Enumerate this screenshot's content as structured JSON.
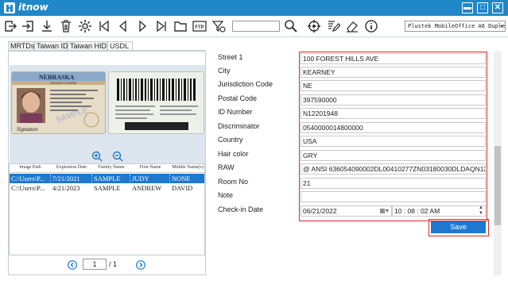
{
  "app": {
    "name": "itnow"
  },
  "window_controls": {
    "minimize": "▬",
    "maximize": "□",
    "close": "✕"
  },
  "toolbar": {
    "icons": [
      "export-icon",
      "login-icon",
      "download-icon",
      "trash-icon",
      "gear-icon",
      "skip-back-icon",
      "prev-icon",
      "next-icon",
      "skip-forward-icon",
      "folder-icon",
      "ftp-icon",
      "filter-icon",
      "search-icon",
      "target-icon",
      "edit-icon",
      "eraser-icon",
      "info-icon"
    ],
    "ftp_label": "FTP",
    "search_value": "",
    "scanner": "Plustek MobileOffice A6 Duplex S"
  },
  "tabs": [
    "MRTDs",
    "Taiwan ID",
    "Taiwan HID",
    "USDL"
  ],
  "active_tab": "USDL",
  "license": {
    "state": "NEBRASKA",
    "header_sub": "DRIVER LICENSE",
    "watermark": "SAMPLE",
    "signature": "Signature"
  },
  "records": {
    "columns": [
      "Image Path",
      "Expiration Date",
      "Family Name",
      "First Name",
      "Middle Name(s)"
    ],
    "rows": [
      [
        "C:\\Users\\P...",
        "7/21/2021",
        "SAMPLE",
        "JUDY",
        "NONE"
      ],
      [
        "C:\\Users\\P...",
        "4/21/2023",
        "SAMPLE",
        "ANDREW",
        "DAVID"
      ]
    ],
    "selected_index": 0
  },
  "pager": {
    "current": "1",
    "total": "/ 1"
  },
  "form": {
    "fields": [
      {
        "label": "Street 1",
        "value": "100 FOREST HILLS AVE"
      },
      {
        "label": "City",
        "value": "KEARNEY"
      },
      {
        "label": "Jurisdiction Code",
        "value": "NE"
      },
      {
        "label": "Postal Code",
        "value": "397590000"
      },
      {
        "label": "ID Number",
        "value": "N12201948"
      },
      {
        "label": "Discriminator",
        "value": "0540000014800000"
      },
      {
        "label": "Country",
        "value": "USA"
      },
      {
        "label": "Hair color",
        "value": "GRY"
      },
      {
        "label": "RAW",
        "value": "@  ANSI 636054090002DL00410277ZN03180030DLDAQN12201948"
      },
      {
        "label": "Room No",
        "value": "21"
      },
      {
        "label": "Note",
        "value": ""
      }
    ],
    "checkin": {
      "label": "Check-in Date",
      "date": "06/21/2022",
      "time": "10 : 08 : 02 AM"
    },
    "save_label": "Save"
  },
  "colors": {
    "accent": "#1e88c8",
    "highlight": "#d62b2b",
    "selected": "#1e78d0"
  }
}
